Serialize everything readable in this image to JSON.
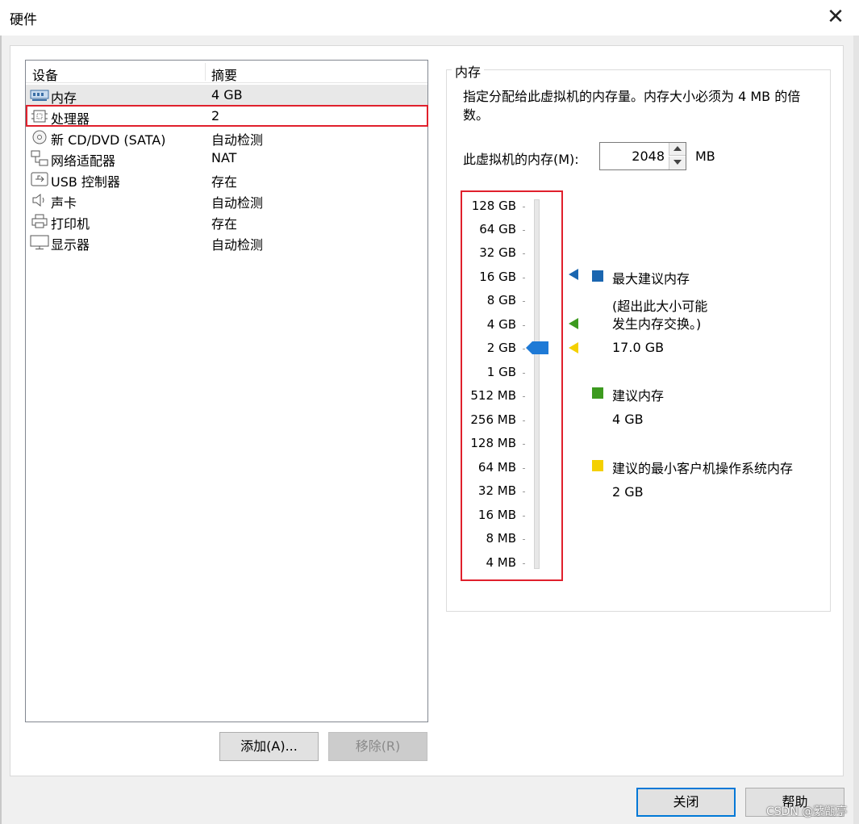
{
  "window": {
    "title": "硬件"
  },
  "devices": {
    "headers": {
      "device": "设备",
      "summary": "摘要"
    },
    "items": [
      {
        "icon": "memory-icon",
        "name": "内存",
        "summary": "4 GB"
      },
      {
        "icon": "processor-icon",
        "name": "处理器",
        "summary": "2"
      },
      {
        "icon": "cd-dvd-icon",
        "name": "新 CD/DVD (SATA)",
        "summary": "自动检测"
      },
      {
        "icon": "network-adapter-icon",
        "name": "网络适配器",
        "summary": "NAT"
      },
      {
        "icon": "usb-icon",
        "name": "USB 控制器",
        "summary": "存在"
      },
      {
        "icon": "sound-card-icon",
        "name": "声卡",
        "summary": "自动检测"
      },
      {
        "icon": "printer-icon",
        "name": "打印机",
        "summary": "存在"
      },
      {
        "icon": "display-icon",
        "name": "显示器",
        "summary": "自动检测"
      }
    ]
  },
  "buttons": {
    "add": "添加(A)...",
    "remove": "移除(R)",
    "close": "关闭",
    "help": "帮助"
  },
  "memory": {
    "group_title": "内存",
    "description": "指定分配给此虚拟机的内存量。内存大小必须为 4 MB 的倍数。",
    "input_label": "此虚拟机的内存(M):",
    "value": "2048",
    "unit": "MB",
    "slider_labels": [
      "128 GB",
      "64 GB",
      "32 GB",
      "16 GB",
      "8 GB",
      "4 GB",
      "2 GB",
      "1 GB",
      "512 MB",
      "256 MB",
      "128 MB",
      "64 MB",
      "32 MB",
      "16 MB",
      "8 MB",
      "4 MB"
    ],
    "slider_selected": "2 GB",
    "legend": {
      "max": {
        "title": "最大建议内存",
        "note_line1": "(超出此大小可能",
        "note_line2": "发生内存交换。)",
        "value": "17.0 GB",
        "color": "#1a66b0"
      },
      "recommended": {
        "title": "建议内存",
        "value": "4 GB",
        "color": "#3c9a1f"
      },
      "min": {
        "title": "建议的最小客户机操作系统内存",
        "value": "2 GB",
        "color": "#f4d000"
      }
    }
  },
  "colors": {
    "highlight": "#e0202c",
    "thumb": "#1e7ad6"
  },
  "watermark": "CSDN @蘩甑亭"
}
